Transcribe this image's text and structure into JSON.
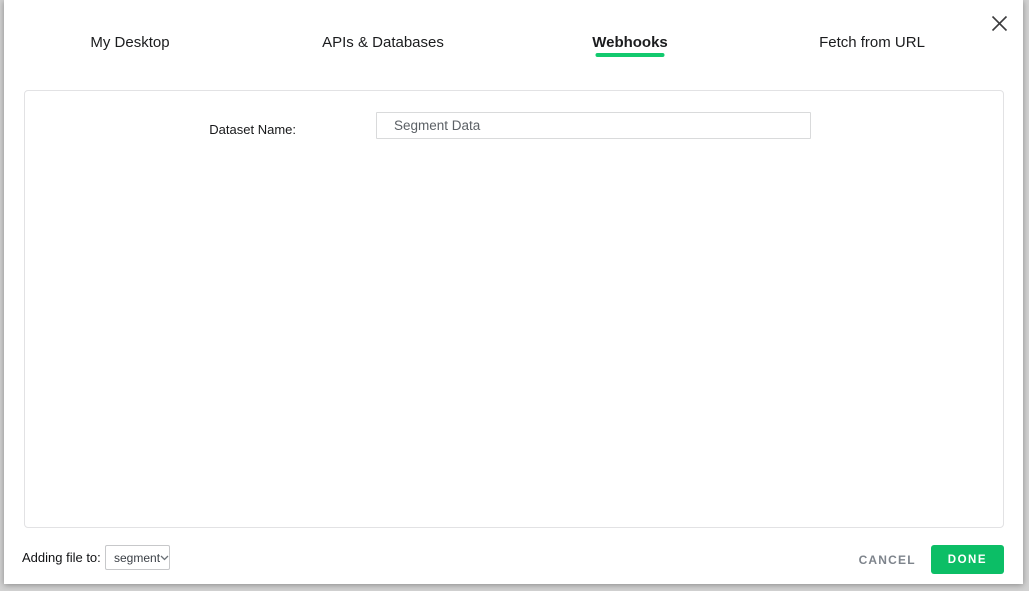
{
  "dialog": {
    "tabs": [
      {
        "label": "My Desktop",
        "active": false
      },
      {
        "label": "APIs & Databases",
        "active": false
      },
      {
        "label": "Webhooks",
        "active": true
      },
      {
        "label": "Fetch from URL",
        "active": false
      }
    ],
    "form": {
      "dataset_name_label": "Dataset Name:",
      "dataset_name_value": "Segment Data"
    },
    "footer": {
      "adding_file_label": "Adding file to:",
      "folder_select_value": "segment",
      "cancel_label": "CANCEL",
      "done_label": "DONE"
    },
    "icons": {
      "close": "close-icon",
      "chevron_down": "chevron-down-icon"
    },
    "colors": {
      "accent_green": "#0cbe66",
      "tab_underline_green": "#12c96e"
    }
  }
}
